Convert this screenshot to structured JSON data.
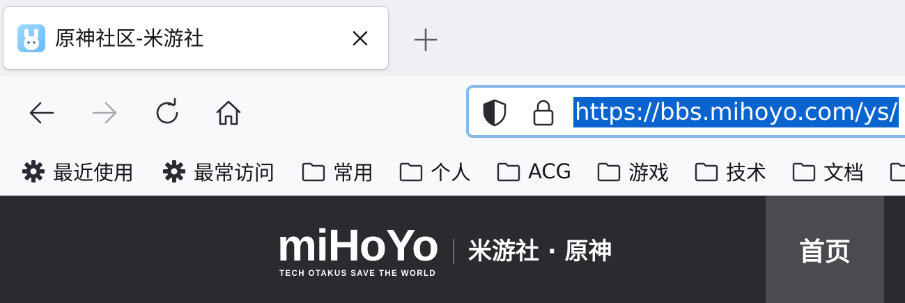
{
  "tab": {
    "title": "原神社区-米游社",
    "favicon_icon": "mihoyo-bbs-favicon",
    "close_icon": "close-icon"
  },
  "new_tab_icon": "plus-icon",
  "toolbar": {
    "back_icon": "arrow-left-icon",
    "forward_icon": "arrow-right-icon",
    "reload_icon": "reload-icon",
    "home_icon": "home-icon"
  },
  "urlbar": {
    "shield_icon": "shield-icon",
    "lock_icon": "lock-icon",
    "url": "https://bbs.mihoyo.com/ys/",
    "selection_color": "#0a64d0",
    "focus_color": "#8ab8ea"
  },
  "bookmarks": [
    {
      "label": "最近使用",
      "icon": "gear-icon"
    },
    {
      "label": "最常访问",
      "icon": "gear-icon"
    },
    {
      "label": "常用",
      "icon": "folder-icon"
    },
    {
      "label": "个人",
      "icon": "folder-icon"
    },
    {
      "label": "ACG",
      "icon": "folder-icon"
    },
    {
      "label": "游戏",
      "icon": "folder-icon"
    },
    {
      "label": "技术",
      "icon": "folder-icon"
    },
    {
      "label": "文档",
      "icon": "folder-icon"
    }
  ],
  "site": {
    "logo_text": "miHoYo",
    "logo_tagline": "TECH OTAKUS SAVE THE WORLD",
    "title": "米游社 · 原神",
    "nav_home": "首页",
    "header_bg": "#2a2b2f",
    "nav_active_bg": "#4a4b4f"
  }
}
